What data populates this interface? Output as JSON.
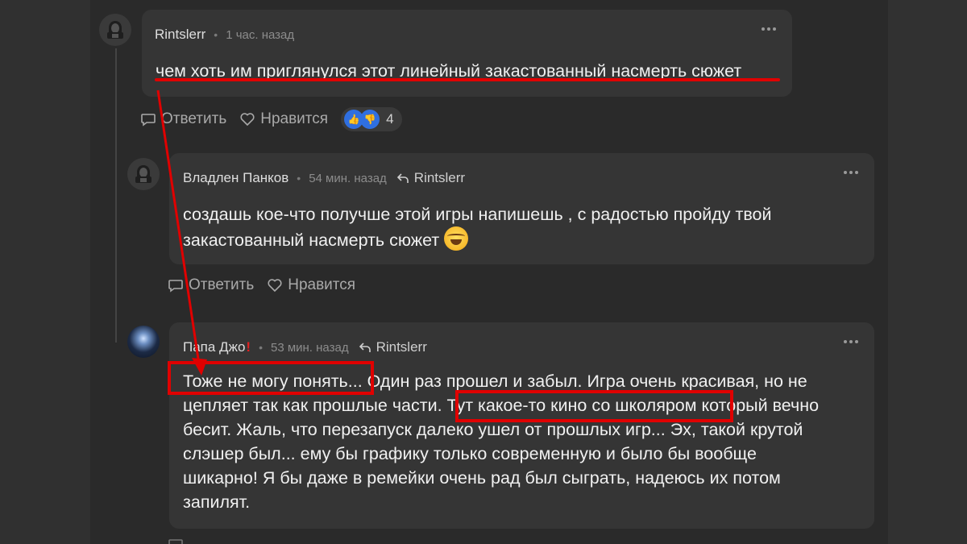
{
  "comments": [
    {
      "author": "Rintslerr",
      "time": "1 час. назад",
      "text": "чем хоть им приглянулся этот линейный закастованный насмерть сюжет",
      "actions": {
        "reply": "Ответить",
        "like": "Нравится"
      },
      "reactions_count": "4"
    },
    {
      "author": "Владлен Панков",
      "time": "54 мин. назад",
      "reply_to": "Rintslerr",
      "text_line1": "создашь кое-что получше этой игры напишешь , с радостью пройду твой",
      "text_line2": "закастованный насмерть сюжет",
      "actions": {
        "reply": "Ответить",
        "like": "Нравится"
      }
    },
    {
      "author": "Папа Джо",
      "badge": "!",
      "time": "53 мин. назад",
      "reply_to": "Rintslerr",
      "lines": [
        {
          "a": "Тоже не могу понять...",
          "b": " Один раз прошел и забыл. Игра очень красивая, но не"
        },
        {
          "a": "цепляет так как прошлые части. ",
          "b": "Тут какое-то кино со школяром",
          "c": " который вечно"
        },
        {
          "a": "бесит. Жаль, что перезапуск далеко ушел от прошлых игр... Эх, такой крутой"
        },
        {
          "a": "слэшер был... ему бы графику только современную и было бы вообще"
        },
        {
          "a": "шикарно! Я бы даже в ремейки очень рад был сыграть, надеюсь их потом"
        },
        {
          "a": "запилят."
        }
      ]
    }
  ],
  "icons": {
    "avatar_default": "hacker-avatar-icon",
    "reply": "speech-bubble-icon",
    "like": "heart-icon",
    "reply_to": "reply-arrow-icon",
    "more": "more-dots-icon"
  },
  "colors": {
    "background": "#2a2a2a",
    "card": "#353535",
    "annotation": "#e00000",
    "reaction": "#2f6fe0"
  }
}
